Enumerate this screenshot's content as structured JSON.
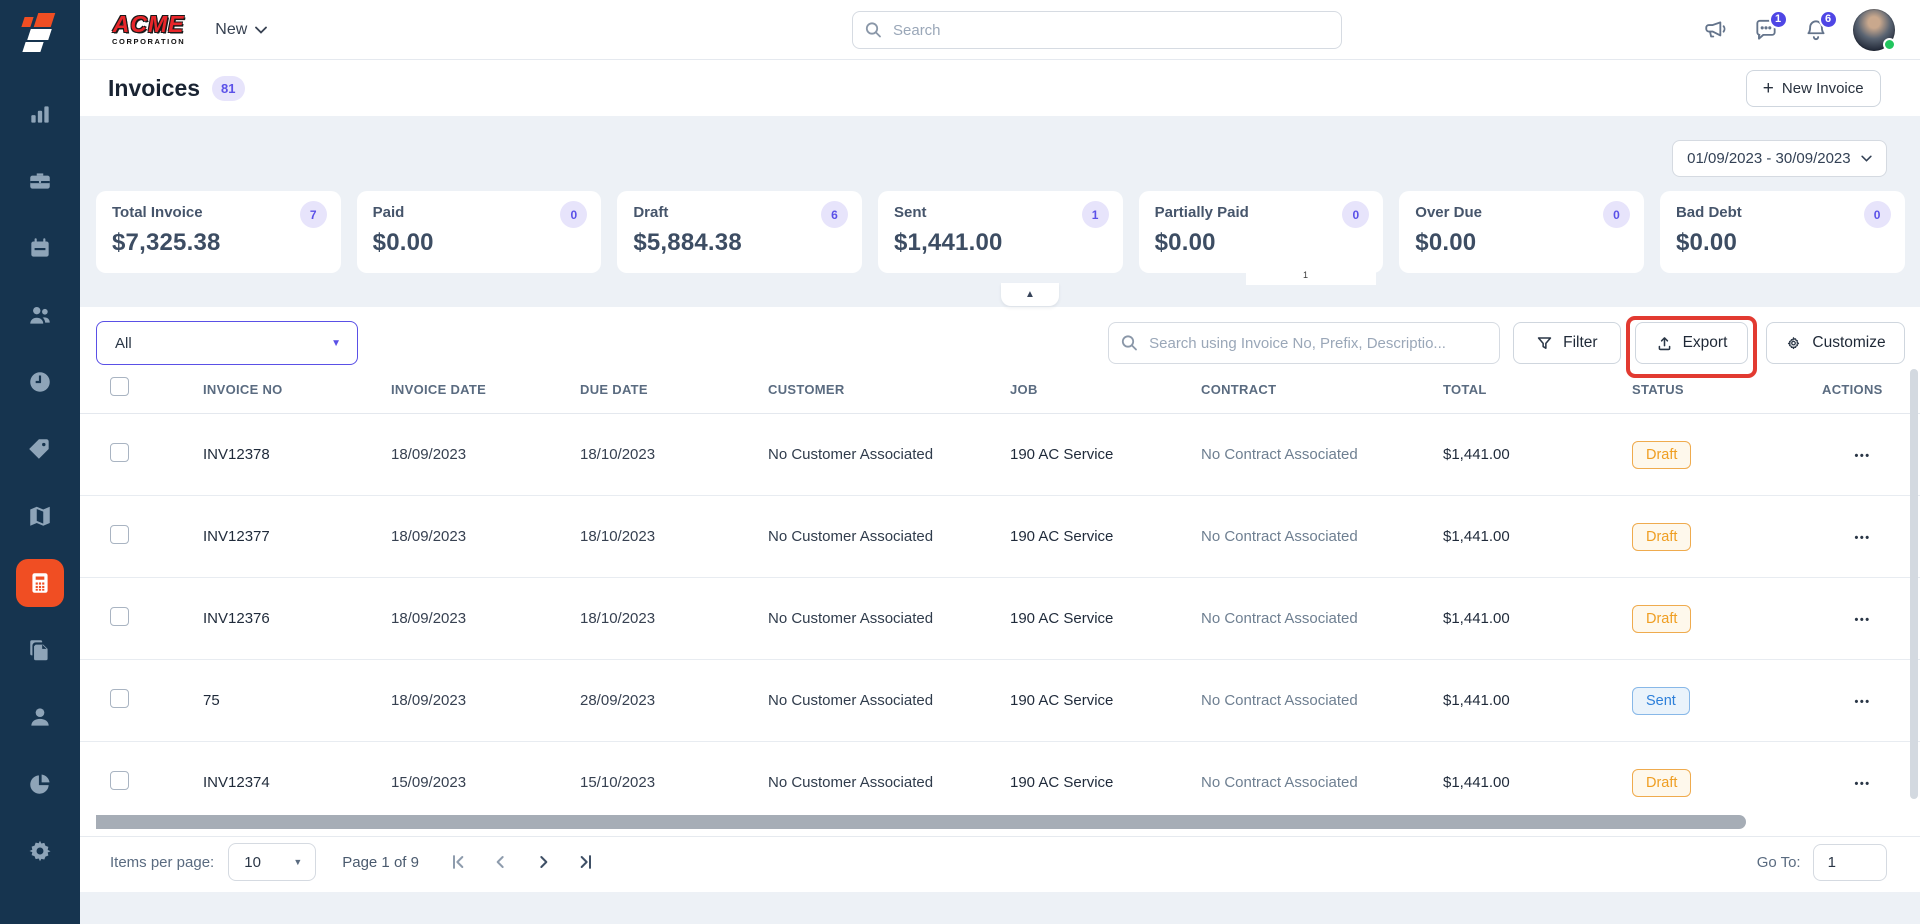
{
  "colors": {
    "sidebar_bg": "#16344f",
    "brand_orange": "#f04e23",
    "accent_indigo": "#5b51e8",
    "annotation_red": "#e23a31",
    "draft_status": "#ef9e22",
    "sent_status": "#2d7fd9"
  },
  "sidebar": {
    "items": [
      "dashboard-bar-chart",
      "jobs-briefcase",
      "schedule-calendar",
      "customers-users",
      "timesheet-clock",
      "tags-pricing",
      "map-dispatch",
      "invoices-active",
      "documents-copy",
      "profile-person",
      "reports-pie-chart",
      "settings-gear"
    ]
  },
  "topbar": {
    "company_name_line1": "ACME",
    "company_name_line2": "CORPORATION",
    "new_menu_label": "New",
    "search_placeholder": "Search",
    "chat_badge": "1",
    "notification_badge": "6"
  },
  "page": {
    "title": "Invoices",
    "count_badge": "81",
    "new_invoice_label": "New Invoice",
    "plus_glyph": "+",
    "date_range": "01/09/2023 - 30/09/2023"
  },
  "stats": [
    {
      "label": "Total Invoice",
      "count": "7",
      "value": "$7,325.38"
    },
    {
      "label": "Paid",
      "count": "0",
      "value": "$0.00"
    },
    {
      "label": "Draft",
      "count": "6",
      "value": "$5,884.38"
    },
    {
      "label": "Sent",
      "count": "1",
      "value": "$1,441.00"
    },
    {
      "label": "Partially Paid",
      "count": "0",
      "value": "$0.00"
    },
    {
      "label": "Over Due",
      "count": "0",
      "value": "$0.00"
    },
    {
      "label": "Bad Debt",
      "count": "0",
      "value": "$0.00"
    }
  ],
  "collapse_tab_glyph": "▲",
  "artifact_text": "1",
  "toolbar": {
    "type_filter_value": "All",
    "search_placeholder": "Search using Invoice No, Prefix, Descriptio...",
    "filter_label": "Filter",
    "export_label": "Export",
    "customize_label": "Customize"
  },
  "table": {
    "columns": [
      "INVOICE NO",
      "INVOICE DATE",
      "DUE DATE",
      "CUSTOMER",
      "JOB",
      "CONTRACT",
      "TOTAL",
      "STATUS",
      "ACTIONS"
    ],
    "rows": [
      {
        "invoice_no": "INV12378",
        "invoice_date": "18/09/2023",
        "due_date": "18/10/2023",
        "customer": "No Customer Associated",
        "job": "190 AC Service",
        "contract": "No Contract Associated",
        "total": "$1,441.00",
        "status": "Draft"
      },
      {
        "invoice_no": "INV12377",
        "invoice_date": "18/09/2023",
        "due_date": "18/10/2023",
        "customer": "No Customer Associated",
        "job": "190 AC Service",
        "contract": "No Contract Associated",
        "total": "$1,441.00",
        "status": "Draft"
      },
      {
        "invoice_no": "INV12376",
        "invoice_date": "18/09/2023",
        "due_date": "18/10/2023",
        "customer": "No Customer Associated",
        "job": "190 AC Service",
        "contract": "No Contract Associated",
        "total": "$1,441.00",
        "status": "Draft"
      },
      {
        "invoice_no": "75",
        "invoice_date": "18/09/2023",
        "due_date": "28/09/2023",
        "customer": "No Customer Associated",
        "job": "190 AC Service",
        "contract": "No Contract Associated",
        "total": "$1,441.00",
        "status": "Sent"
      },
      {
        "invoice_no": "INV12374",
        "invoice_date": "15/09/2023",
        "due_date": "15/10/2023",
        "customer": "No Customer Associated",
        "job": "190 AC Service",
        "contract": "No Contract Associated",
        "total": "$1,441.00",
        "status": "Draft"
      }
    ],
    "actions_glyph": "•••"
  },
  "pagination": {
    "items_per_page_label": "Items per page:",
    "items_per_page_value": "10",
    "page_info": "Page 1 of 9",
    "go_to_label": "Go To:",
    "go_to_value": "1"
  }
}
